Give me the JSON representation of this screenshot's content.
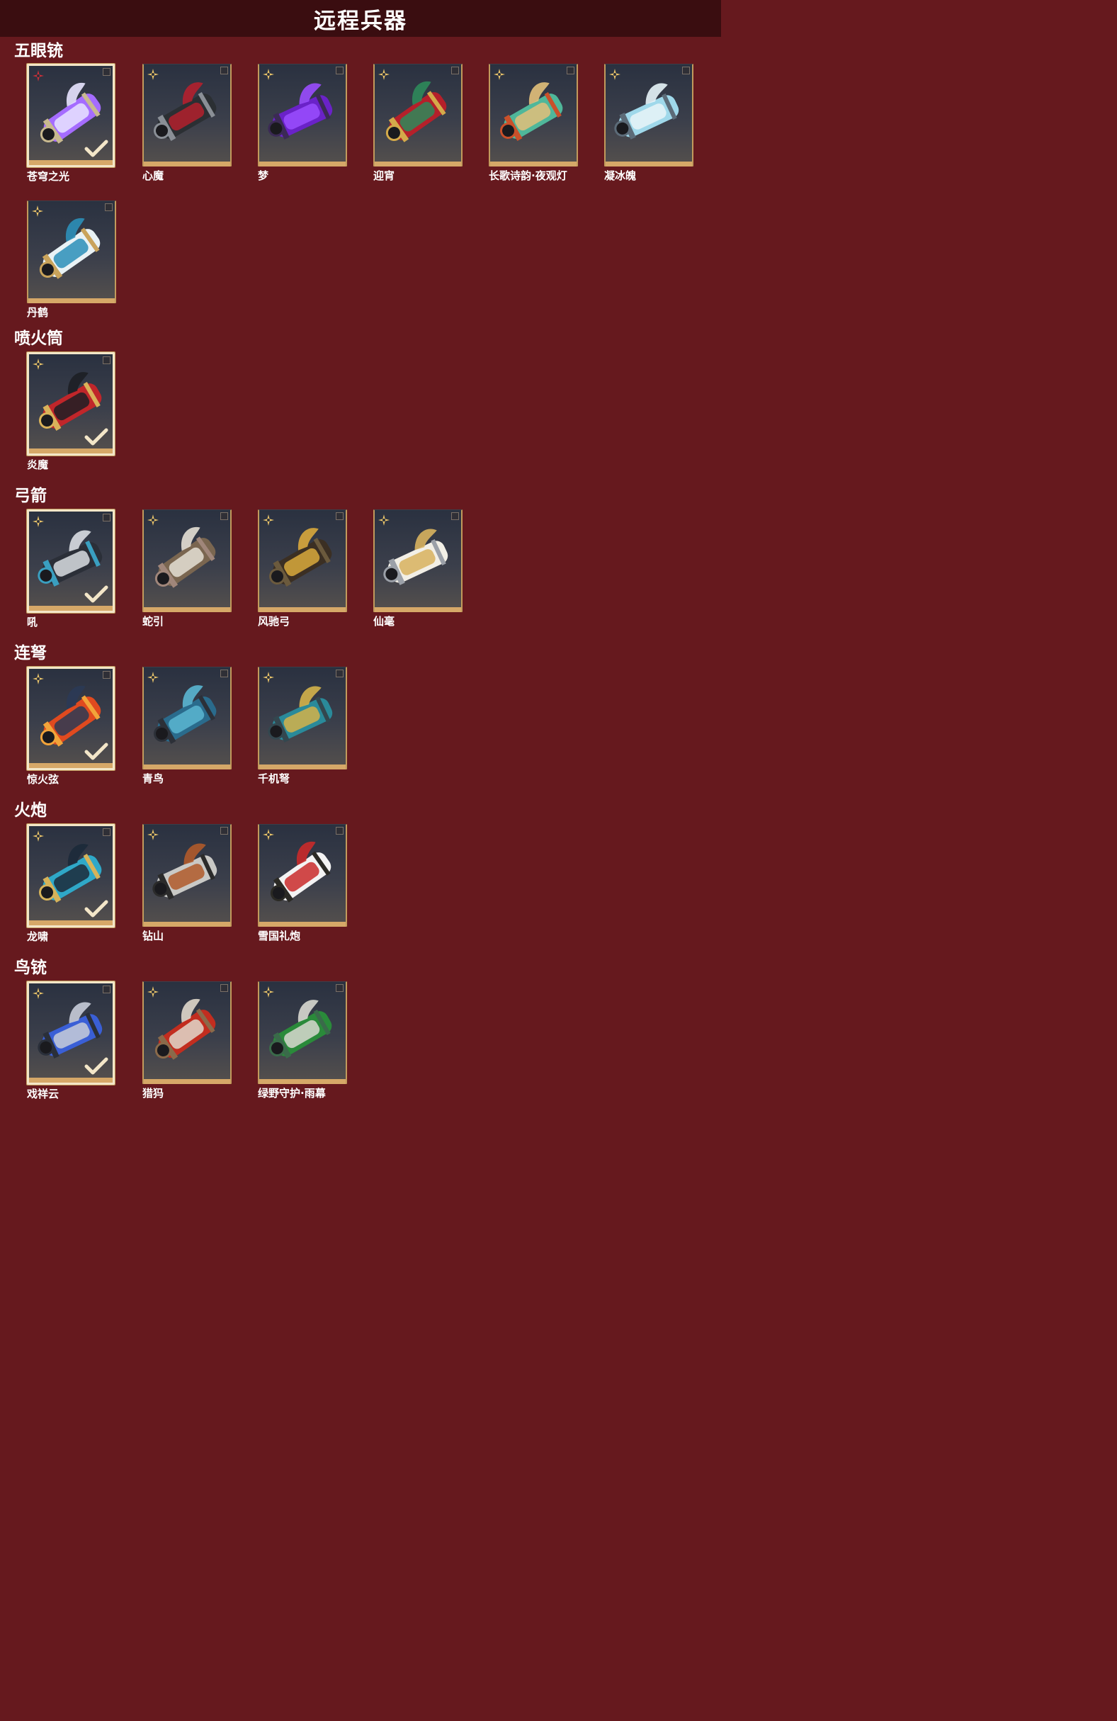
{
  "header": {
    "title": "远程兵器"
  },
  "categories": [
    {
      "title": "五眼铳",
      "items": [
        {
          "name": "苍穹之光",
          "selected": true,
          "rarity": "red-star",
          "colors": [
            "#a56cff",
            "#e8e4ff",
            "#c8b98f"
          ]
        },
        {
          "name": "心魔",
          "selected": false,
          "rarity": "gold-star",
          "colors": [
            "#2b2f33",
            "#b3202d",
            "#8a8f96"
          ]
        },
        {
          "name": "梦",
          "selected": false,
          "rarity": "gold-star",
          "colors": [
            "#6a22c8",
            "#9a4dff",
            "#3b2a55"
          ]
        },
        {
          "name": "迎宵",
          "selected": false,
          "rarity": "gold-star",
          "colors": [
            "#b5202a",
            "#2e8a5a",
            "#d4aa4a"
          ]
        },
        {
          "name": "长歌诗韵·夜观灯",
          "selected": false,
          "rarity": "gold-star",
          "colors": [
            "#4fb79a",
            "#e2c07a",
            "#c9502a"
          ]
        },
        {
          "name": "凝冰魄",
          "selected": false,
          "rarity": "gold-star",
          "colors": [
            "#9fd8ea",
            "#e7f4f8",
            "#5c6b78"
          ]
        },
        {
          "name": "丹鹤",
          "selected": false,
          "rarity": "gold-star",
          "colors": [
            "#e9f2f5",
            "#2c8fb8",
            "#c9a35b"
          ]
        }
      ]
    },
    {
      "title": "喷火筒",
      "items": [
        {
          "name": "炎魔",
          "selected": true,
          "rarity": "gold-star",
          "colors": [
            "#c0262a",
            "#1d1f25",
            "#d9b25a"
          ]
        }
      ]
    },
    {
      "title": "弓箭",
      "items": [
        {
          "name": "吼",
          "selected": true,
          "rarity": "gold-star",
          "colors": [
            "#2b2f38",
            "#d9dde2",
            "#3a9fc0"
          ]
        },
        {
          "name": "蛇引",
          "selected": false,
          "rarity": "gold-star",
          "colors": [
            "#7a6650",
            "#e5e0d5",
            "#a0867a"
          ]
        },
        {
          "name": "风驰弓",
          "selected": false,
          "rarity": "gold-star",
          "colors": [
            "#3b2f23",
            "#d9a93c",
            "#6b5a3d"
          ]
        },
        {
          "name": "仙毫",
          "selected": false,
          "rarity": "gold-star",
          "colors": [
            "#f2efe6",
            "#d8b25e",
            "#9ba0a8"
          ]
        }
      ]
    },
    {
      "title": "连弩",
      "items": [
        {
          "name": "惊火弦",
          "selected": true,
          "rarity": "gold-star",
          "colors": [
            "#e04a1f",
            "#2b3a55",
            "#f2a43a"
          ]
        },
        {
          "name": "青鸟",
          "selected": false,
          "rarity": "gold-star",
          "colors": [
            "#2a6b8c",
            "#5ab6d1",
            "#2c3038"
          ]
        },
        {
          "name": "千机弩",
          "selected": false,
          "rarity": "gold-star",
          "colors": [
            "#2a8a9a",
            "#d4b24a",
            "#33474f"
          ]
        }
      ]
    },
    {
      "title": "火炮",
      "items": [
        {
          "name": "龙啸",
          "selected": true,
          "rarity": "gold-star",
          "colors": [
            "#2fa8c8",
            "#1c2a3a",
            "#d6b35a"
          ]
        },
        {
          "name": "钻山",
          "selected": false,
          "rarity": "gold-star",
          "colors": [
            "#c9c9c6",
            "#b05a2a",
            "#2b2b2b"
          ]
        },
        {
          "name": "雪国礼炮",
          "selected": false,
          "rarity": "gold-star",
          "colors": [
            "#f3f3f3",
            "#c92a2a",
            "#2b2a25"
          ]
        }
      ]
    },
    {
      "title": "鸟铳",
      "items": [
        {
          "name": "戏祥云",
          "selected": true,
          "rarity": "gold-star",
          "colors": [
            "#3a5fd6",
            "#c8ccd8",
            "#2a2f3a"
          ]
        },
        {
          "name": "猎犸",
          "selected": false,
          "rarity": "gold-star",
          "colors": [
            "#c22d1f",
            "#e0d8cb",
            "#8a6a4a"
          ]
        },
        {
          "name": "绿野守护·雨幕",
          "selected": false,
          "rarity": "gold-star",
          "colors": [
            "#2a8a3a",
            "#d8d8d0",
            "#3a6a4a"
          ]
        }
      ]
    }
  ]
}
